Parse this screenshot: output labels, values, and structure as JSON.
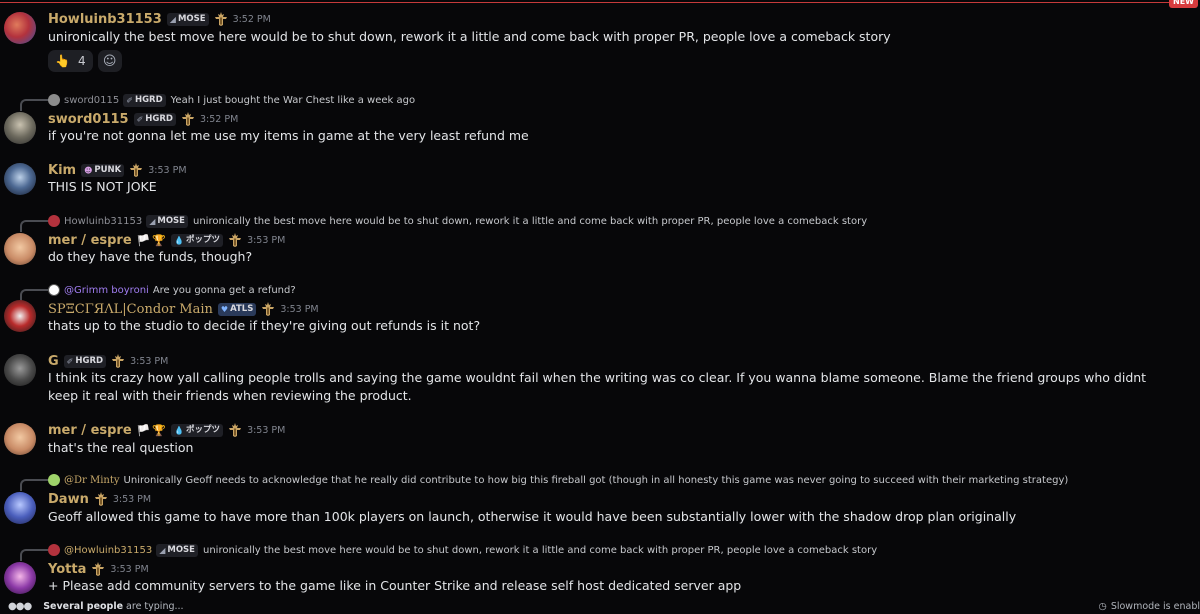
{
  "new_badge": "NEW",
  "crest_icon": "crest-icon",
  "messages": [
    {
      "username": "Howluinb31153",
      "name_color": "#c9aa6b",
      "tag": "MOSE",
      "tag_icon": "◢",
      "time": "3:52 PM",
      "text": "unironically the best move here would be to shut down, rework it a little and come back with proper PR, people love a comeback story",
      "reactions": {
        "emoji": "👆",
        "count": "4"
      }
    },
    {
      "reply": {
        "name": "sword0115",
        "tag": "HGRD",
        "text": "Yeah I just bought the War Chest like a week ago"
      },
      "username": "sword0115",
      "name_color": "#c9aa6b",
      "tag": "HGRD",
      "tag_icon": "✐",
      "time": "3:52 PM",
      "text": "if you're not gonna let me use my items in game at the very least refund me"
    },
    {
      "username": "Kim",
      "name_color": "#c9aa6b",
      "tag": "PUNK",
      "tag_icon": "☻",
      "time": "3:53 PM",
      "text": "THIS IS NOT JOKE"
    },
    {
      "reply": {
        "name": "Howluinb31153",
        "tag": "MOSE",
        "text": "unironically the best move here would be to shut down, rework it a little and come back with proper PR, people love a comeback story"
      },
      "username": "mer / espre",
      "name_color": "#c9aa6b",
      "tag": "ポップツ",
      "tag_icon": "💧",
      "time": "3:53 PM",
      "text": "do they have the funds, though?"
    },
    {
      "reply": {
        "name": "@Grimm boyroni",
        "text": "Are you gonna get a refund?"
      },
      "username": "SPΞCΓЯΛL|Condor Main",
      "name_color": "#c9aa6b",
      "tag": "ATLS",
      "tag_icon": "♥",
      "time": "3:53 PM",
      "text": "thats up to the studio to decide if they're giving out refunds is it not?"
    },
    {
      "username": "G",
      "name_color": "#c9aa6b",
      "tag": "HGRD",
      "tag_icon": "✐",
      "time": "3:53 PM",
      "text": "I think its crazy how yall calling people trolls and saying the game wouldnt fail when the writing was co clear. If you wanna blame someone. Blame the friend groups who didnt keep it real with their friends when reviewing the product."
    },
    {
      "username": "mer / espre",
      "name_color": "#c9aa6b",
      "tag": "ポップツ",
      "tag_icon": "💧",
      "time": "3:53 PM",
      "text": "that's the real question"
    },
    {
      "reply": {
        "name": "@Dr Minty",
        "text": "Unironically Geoff needs to acknowledge that he really did contribute to how big this fireball got (though in all honesty this game was never going to succeed with their marketing strategy)"
      },
      "username": "Dawn",
      "name_color": "#c9aa6b",
      "time": "3:53 PM",
      "text": "Geoff allowed this game to have more than 100k players on launch, otherwise it would have been substantially lower with the shadow drop plan originally"
    },
    {
      "reply": {
        "name": "@Howluinb31153",
        "tag": "MOSE",
        "text": "unironically the best move here would be to shut down, rework it a little and come back with proper PR, people love a comeback story"
      },
      "username": "Yotta",
      "name_color": "#c9aa6b",
      "time": "3:53 PM",
      "text": "+ Please add community servers to the game like in Counter Strike and release self host dedicated server app"
    }
  ],
  "typing": {
    "names": "Several people",
    "suffix": "are typing..."
  },
  "slowmode": "Slowmode is enabl"
}
